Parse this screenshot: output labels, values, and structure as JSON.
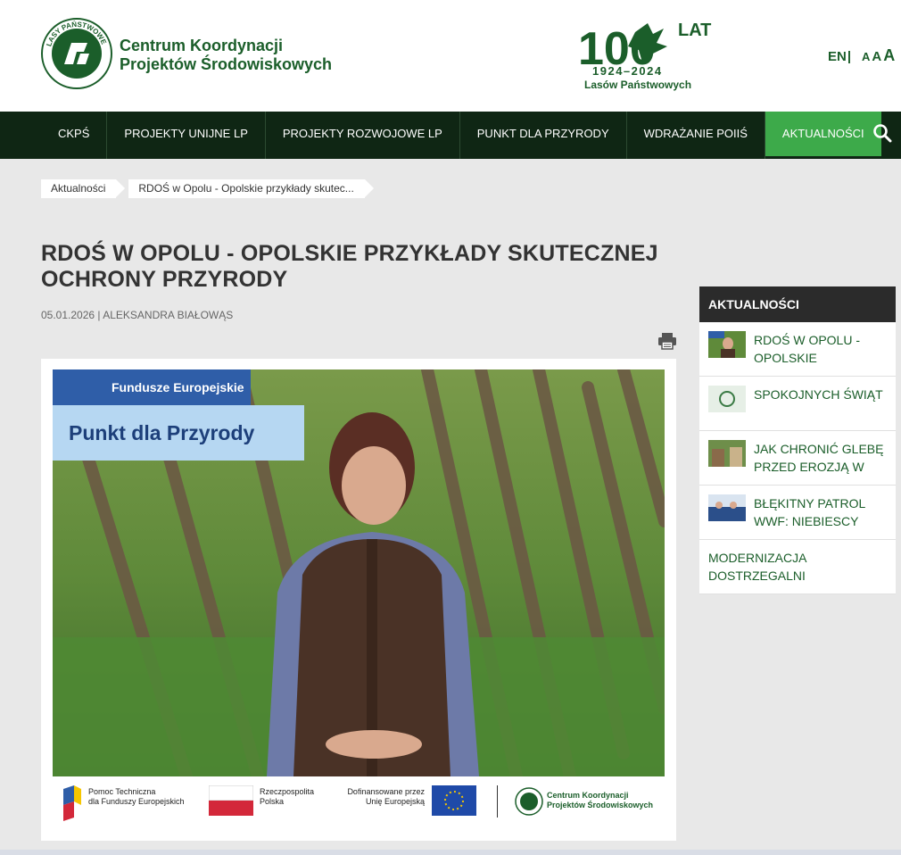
{
  "header": {
    "brand_line1": "Centrum Koordynacji",
    "brand_line2": "Projektów Środowiskowych",
    "logo_ring_text": "LASY PAŃSTWOWE",
    "anniv_big": "100",
    "anniv_lat": "LAT",
    "anniv_years": "1924–2024",
    "anniv_sub": "Lasów Państwowych",
    "lang": "EN",
    "lang_sep": "|",
    "font_small": "A",
    "font_mid": "A",
    "font_large": "A"
  },
  "nav": {
    "items": [
      {
        "label": "CKPŚ"
      },
      {
        "label": "PROJEKTY UNIJNE LP"
      },
      {
        "label": "PROJEKTY ROZWOJOWE LP"
      },
      {
        "label": "PUNKT DLA PRZYRODY"
      },
      {
        "label": "WDRAŻANIE POIIŚ"
      },
      {
        "label": "AKTUALNOŚCI"
      }
    ],
    "active_color": "#3daa4a"
  },
  "breadcrumb": {
    "items": [
      {
        "label": "Aktualności"
      },
      {
        "label": "RDOŚ w Opolu - Opolskie przykłady skutec..."
      }
    ]
  },
  "article": {
    "title_line1": "RDOŚ W OPOLU - OPOLSKIE PRZYKŁADY SKUTECZNEJ",
    "title_line2": "OCHRONY PRZYRODY",
    "date": "05.01.2026",
    "meta_sep": "|",
    "author": "ALEKSANDRA BIAŁOWĄS",
    "image": {
      "badge_top": "Fundusze Europejskie",
      "badge_main": "Punkt dla Przyrody",
      "logo1_line1": "Pomoc Techniczna",
      "logo1_line2": "dla Funduszy Europejskich",
      "logo2_line1": "Rzeczpospolita",
      "logo2_line2": "Polska",
      "logo3_line1": "Dofinansowane przez",
      "logo3_line2": "Unię Europejską",
      "logo4_line1": "Centrum Koordynacji",
      "logo4_line2": "Projektów Środowiskowych"
    }
  },
  "sidebar": {
    "heading": "AKTUALNOŚCI",
    "items": [
      {
        "title": "RDOŚ W OPOLU - OPOLSKIE PRZYKŁADY"
      },
      {
        "title": "SPOKOJNYCH ŚWIĄT"
      },
      {
        "title": "JAK CHRONIĆ GLEBĘ PRZED EROZJĄ W"
      },
      {
        "title": "BŁĘKITNY PATROL WWF: NIEBIESCY"
      },
      {
        "title": "MODERNIZACJA DOSTRZEGALNI"
      }
    ]
  },
  "colors": {
    "brand_green": "#1b5e2a",
    "nav_bg": "#0f2614",
    "sidebar_head": "#2b2b2b"
  }
}
